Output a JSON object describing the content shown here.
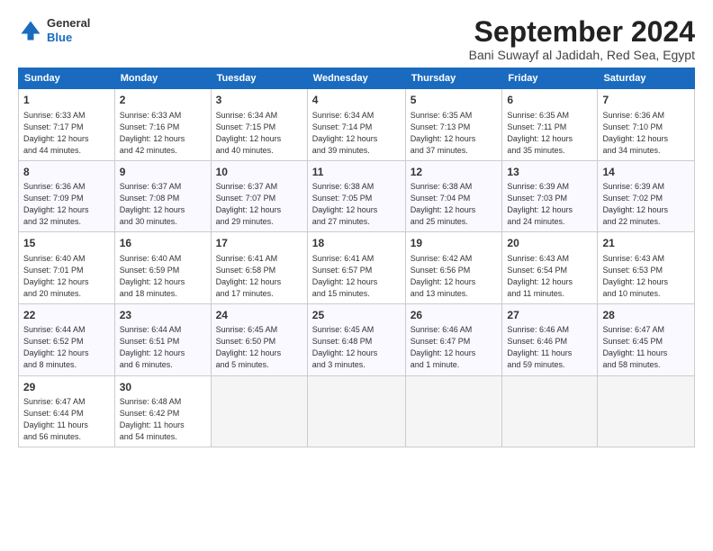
{
  "header": {
    "logo_line1": "General",
    "logo_line2": "Blue",
    "title": "September 2024",
    "subtitle": "Bani Suwayf al Jadidah, Red Sea, Egypt"
  },
  "calendar": {
    "days_of_week": [
      "Sunday",
      "Monday",
      "Tuesday",
      "Wednesday",
      "Thursday",
      "Friday",
      "Saturday"
    ],
    "weeks": [
      [
        {
          "day": "1",
          "detail": "Sunrise: 6:33 AM\nSunset: 7:17 PM\nDaylight: 12 hours\nand 44 minutes."
        },
        {
          "day": "2",
          "detail": "Sunrise: 6:33 AM\nSunset: 7:16 PM\nDaylight: 12 hours\nand 42 minutes."
        },
        {
          "day": "3",
          "detail": "Sunrise: 6:34 AM\nSunset: 7:15 PM\nDaylight: 12 hours\nand 40 minutes."
        },
        {
          "day": "4",
          "detail": "Sunrise: 6:34 AM\nSunset: 7:14 PM\nDaylight: 12 hours\nand 39 minutes."
        },
        {
          "day": "5",
          "detail": "Sunrise: 6:35 AM\nSunset: 7:13 PM\nDaylight: 12 hours\nand 37 minutes."
        },
        {
          "day": "6",
          "detail": "Sunrise: 6:35 AM\nSunset: 7:11 PM\nDaylight: 12 hours\nand 35 minutes."
        },
        {
          "day": "7",
          "detail": "Sunrise: 6:36 AM\nSunset: 7:10 PM\nDaylight: 12 hours\nand 34 minutes."
        }
      ],
      [
        {
          "day": "8",
          "detail": "Sunrise: 6:36 AM\nSunset: 7:09 PM\nDaylight: 12 hours\nand 32 minutes."
        },
        {
          "day": "9",
          "detail": "Sunrise: 6:37 AM\nSunset: 7:08 PM\nDaylight: 12 hours\nand 30 minutes."
        },
        {
          "day": "10",
          "detail": "Sunrise: 6:37 AM\nSunset: 7:07 PM\nDaylight: 12 hours\nand 29 minutes."
        },
        {
          "day": "11",
          "detail": "Sunrise: 6:38 AM\nSunset: 7:05 PM\nDaylight: 12 hours\nand 27 minutes."
        },
        {
          "day": "12",
          "detail": "Sunrise: 6:38 AM\nSunset: 7:04 PM\nDaylight: 12 hours\nand 25 minutes."
        },
        {
          "day": "13",
          "detail": "Sunrise: 6:39 AM\nSunset: 7:03 PM\nDaylight: 12 hours\nand 24 minutes."
        },
        {
          "day": "14",
          "detail": "Sunrise: 6:39 AM\nSunset: 7:02 PM\nDaylight: 12 hours\nand 22 minutes."
        }
      ],
      [
        {
          "day": "15",
          "detail": "Sunrise: 6:40 AM\nSunset: 7:01 PM\nDaylight: 12 hours\nand 20 minutes."
        },
        {
          "day": "16",
          "detail": "Sunrise: 6:40 AM\nSunset: 6:59 PM\nDaylight: 12 hours\nand 18 minutes."
        },
        {
          "day": "17",
          "detail": "Sunrise: 6:41 AM\nSunset: 6:58 PM\nDaylight: 12 hours\nand 17 minutes."
        },
        {
          "day": "18",
          "detail": "Sunrise: 6:41 AM\nSunset: 6:57 PM\nDaylight: 12 hours\nand 15 minutes."
        },
        {
          "day": "19",
          "detail": "Sunrise: 6:42 AM\nSunset: 6:56 PM\nDaylight: 12 hours\nand 13 minutes."
        },
        {
          "day": "20",
          "detail": "Sunrise: 6:43 AM\nSunset: 6:54 PM\nDaylight: 12 hours\nand 11 minutes."
        },
        {
          "day": "21",
          "detail": "Sunrise: 6:43 AM\nSunset: 6:53 PM\nDaylight: 12 hours\nand 10 minutes."
        }
      ],
      [
        {
          "day": "22",
          "detail": "Sunrise: 6:44 AM\nSunset: 6:52 PM\nDaylight: 12 hours\nand 8 minutes."
        },
        {
          "day": "23",
          "detail": "Sunrise: 6:44 AM\nSunset: 6:51 PM\nDaylight: 12 hours\nand 6 minutes."
        },
        {
          "day": "24",
          "detail": "Sunrise: 6:45 AM\nSunset: 6:50 PM\nDaylight: 12 hours\nand 5 minutes."
        },
        {
          "day": "25",
          "detail": "Sunrise: 6:45 AM\nSunset: 6:48 PM\nDaylight: 12 hours\nand 3 minutes."
        },
        {
          "day": "26",
          "detail": "Sunrise: 6:46 AM\nSunset: 6:47 PM\nDaylight: 12 hours\nand 1 minute."
        },
        {
          "day": "27",
          "detail": "Sunrise: 6:46 AM\nSunset: 6:46 PM\nDaylight: 11 hours\nand 59 minutes."
        },
        {
          "day": "28",
          "detail": "Sunrise: 6:47 AM\nSunset: 6:45 PM\nDaylight: 11 hours\nand 58 minutes."
        }
      ],
      [
        {
          "day": "29",
          "detail": "Sunrise: 6:47 AM\nSunset: 6:44 PM\nDaylight: 11 hours\nand 56 minutes."
        },
        {
          "day": "30",
          "detail": "Sunrise: 6:48 AM\nSunset: 6:42 PM\nDaylight: 11 hours\nand 54 minutes."
        },
        {
          "day": "",
          "detail": ""
        },
        {
          "day": "",
          "detail": ""
        },
        {
          "day": "",
          "detail": ""
        },
        {
          "day": "",
          "detail": ""
        },
        {
          "day": "",
          "detail": ""
        }
      ]
    ]
  }
}
